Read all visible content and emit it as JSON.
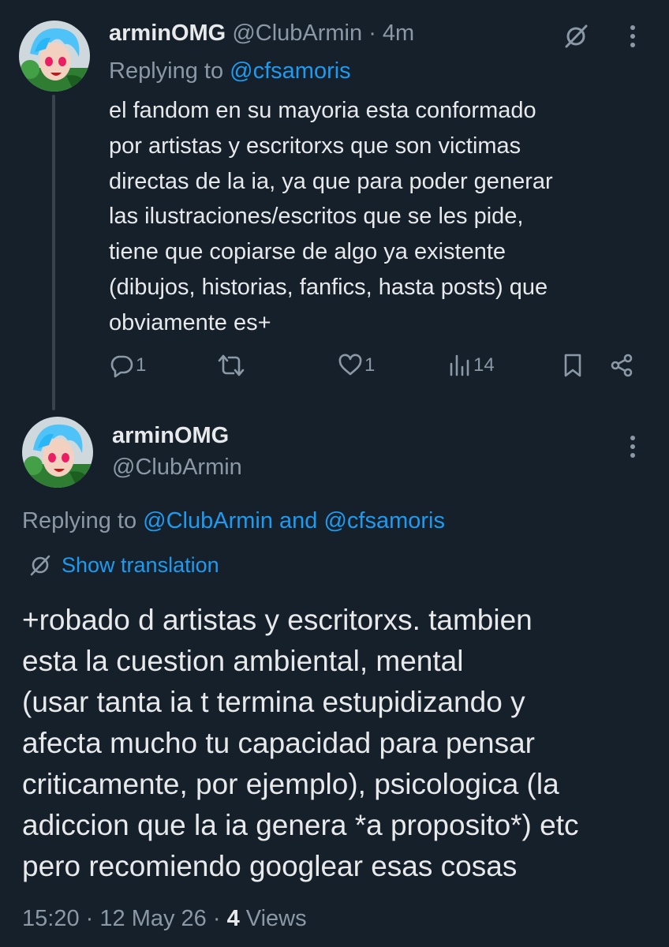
{
  "tweet1": {
    "display_name": "arminOMG",
    "handle": "@ClubArmin",
    "separator": "·",
    "time": "4m",
    "replying_prefix": "Replying to ",
    "replying_to": "@cfsamoris",
    "text": "el fandom en su mayoria esta conformado\npor artistas y escritorxs que son victimas\ndirectas de la ia, ya que para poder generar\nlas ilustraciones/escritos que se les pide,\ntiene que copiarse de algo ya existente\n(dibujos, historias, fanfics, hasta posts) que\nobviamente es+",
    "actions": {
      "reply_count": "1",
      "retweet_count": "",
      "like_count": "1",
      "views_count": "14"
    },
    "icons": {
      "translate": "translate-slash-icon",
      "more": "more-vertical-icon",
      "reply": "reply-bubble-icon",
      "retweet": "retweet-icon",
      "like": "heart-icon",
      "views": "views-bars-icon",
      "bookmark": "bookmark-icon",
      "share": "share-icon"
    }
  },
  "tweet2": {
    "display_name": "arminOMG",
    "handle": "@ClubArmin",
    "replying_prefix": "Replying to ",
    "replying_to_1": "@ClubArmin",
    "replying_and": " and ",
    "replying_to_2": "@cfsamoris",
    "show_translation": "Show translation",
    "text": "+robado d artistas y escritorxs. tambien\nesta la cuestion ambiental, mental\n(usar tanta ia t termina estupidizando y\nafecta mucho tu capacidad para pensar\ncriticamente, por ejemplo), psicologica (la\nadiccion que la ia genera *a proposito*) etc\npero recomiendo googlear esas cosas",
    "time": "15:20",
    "separator": "·",
    "date": "12 May 26",
    "views_count": "4",
    "views_label": "Views"
  },
  "colors": {
    "background": "#15202b",
    "text_primary": "#e7e9ea",
    "text_secondary": "#8b98a5",
    "accent": "#1d9bf0",
    "thread_line": "#38444d"
  }
}
